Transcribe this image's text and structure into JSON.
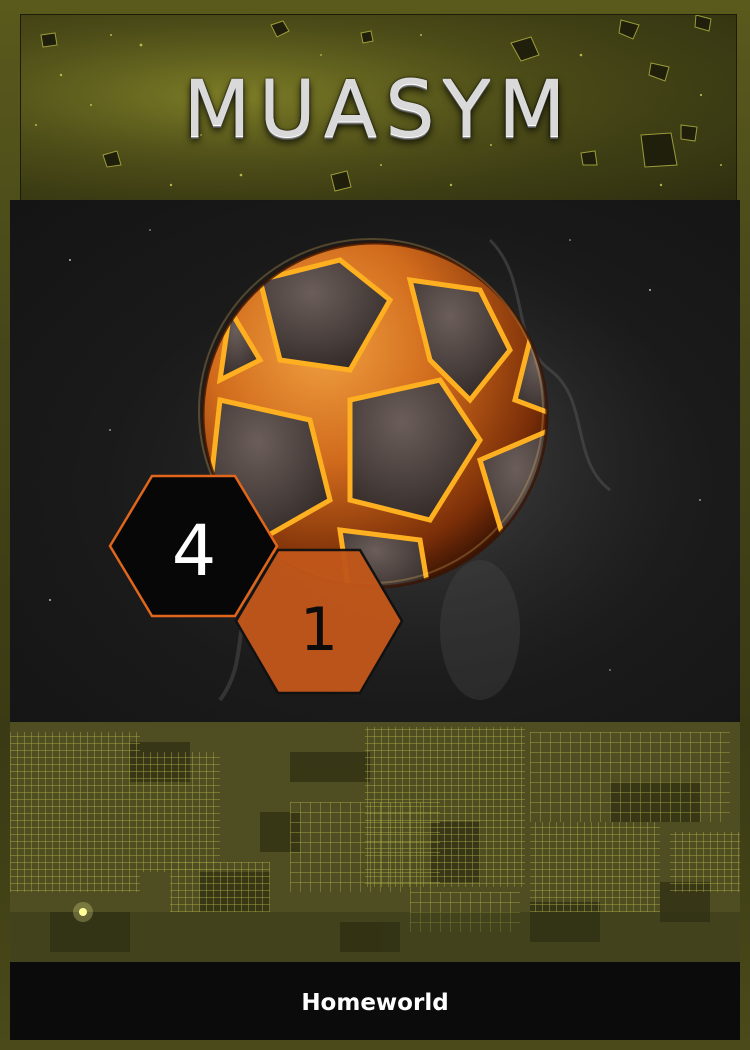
{
  "card": {
    "title": "MUASYM",
    "name": "Homeworld",
    "stats": {
      "primary_value": "4",
      "secondary_value": "1"
    },
    "colors": {
      "frame": "#4e4e1c",
      "accent_orange": "#e0661b",
      "lava": "#ffb020",
      "grid": "#b8b84a",
      "name_bar": "#0b0b0b"
    },
    "icons": {
      "planet": "lava-planet",
      "primary_hex": "black-hexagon",
      "secondary_hex": "orange-hexagon"
    }
  }
}
